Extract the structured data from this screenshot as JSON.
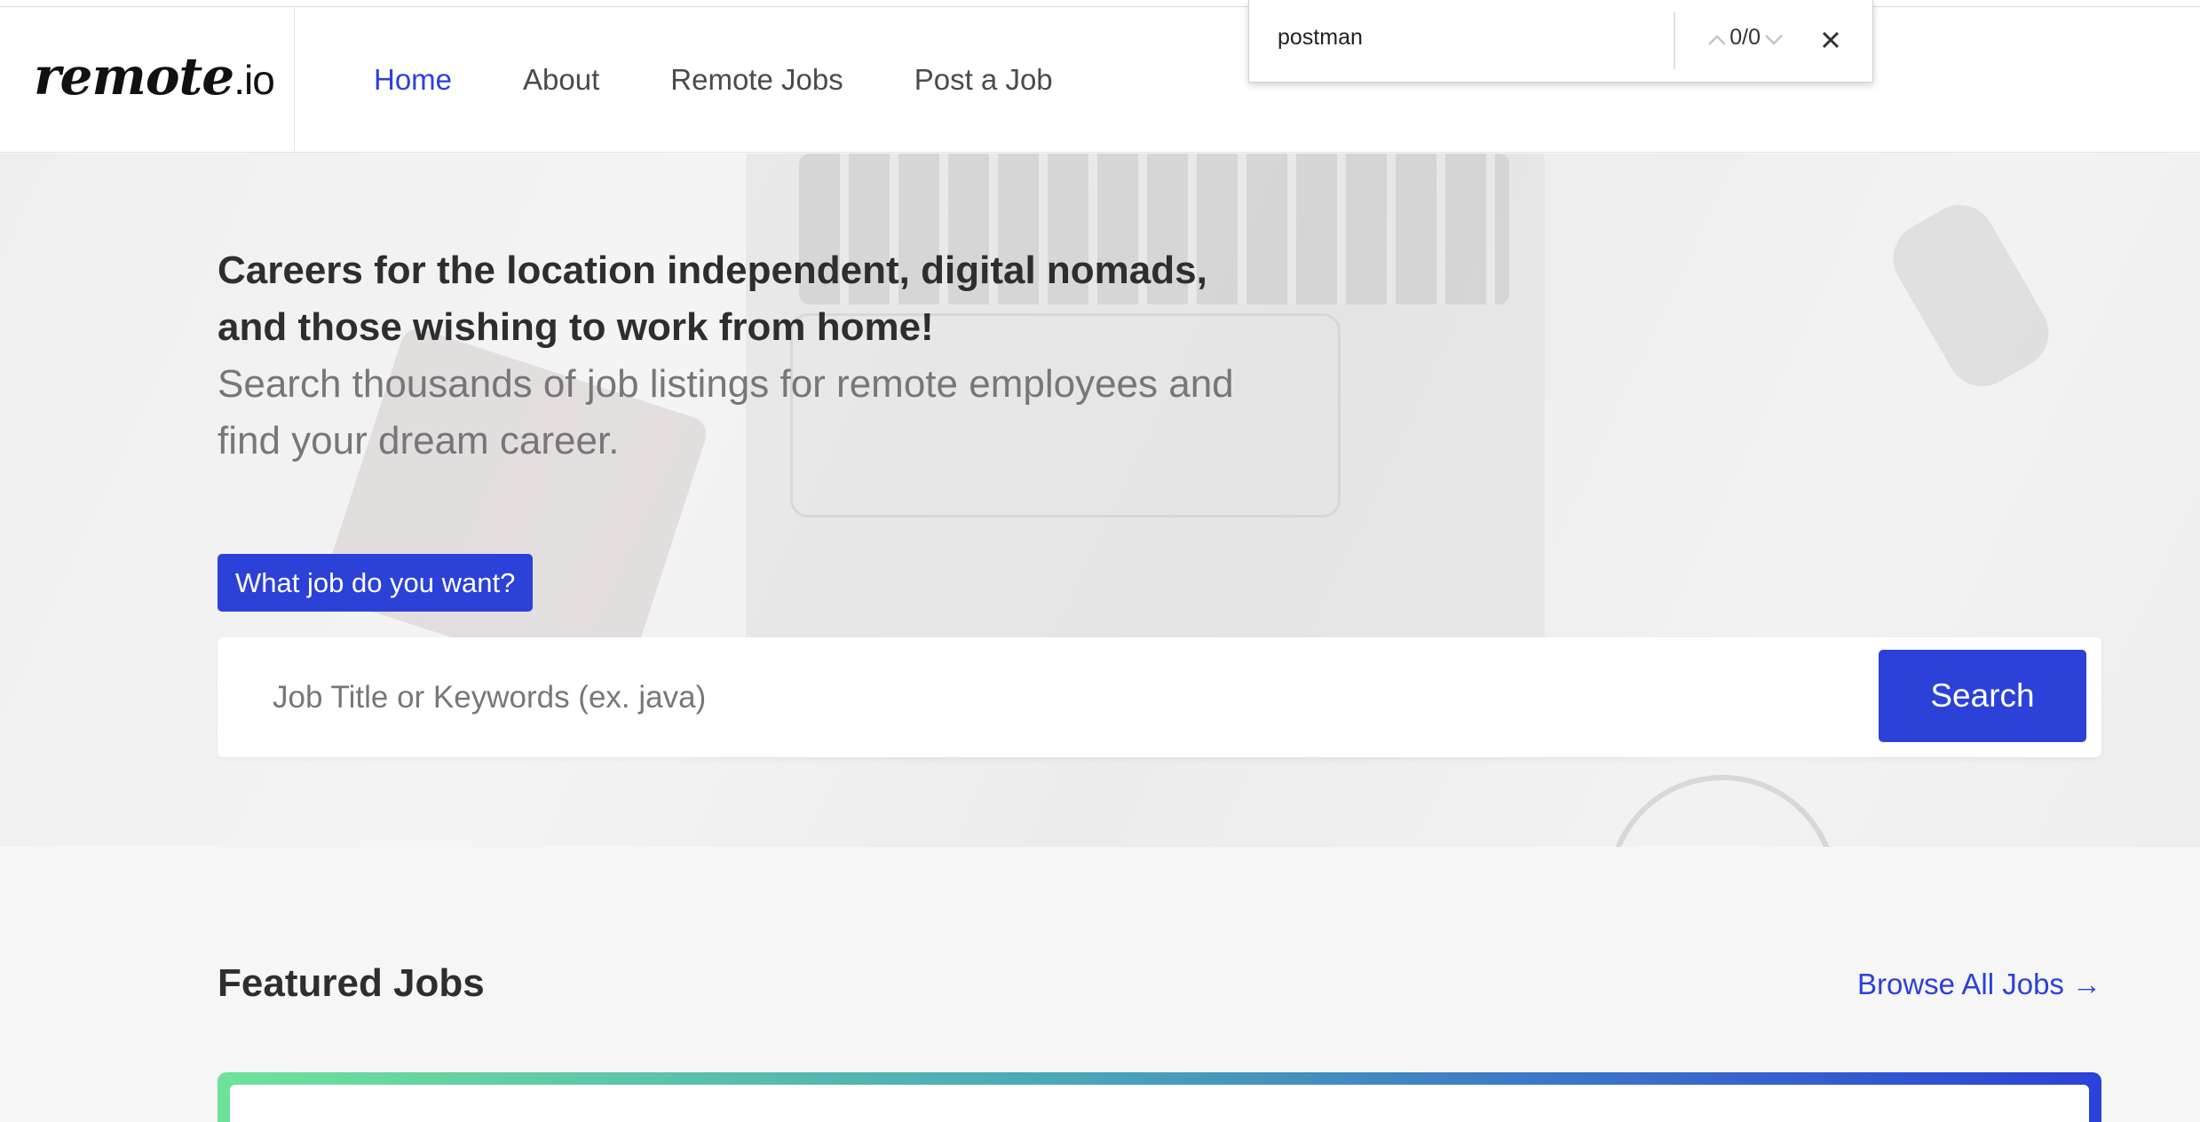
{
  "header": {
    "logo_main": "remote",
    "logo_tld": ".io",
    "nav": [
      {
        "label": "Home",
        "active": true
      },
      {
        "label": "About",
        "active": false
      },
      {
        "label": "Remote Jobs",
        "active": false
      },
      {
        "label": "Post a Job",
        "active": false
      }
    ]
  },
  "find_bar": {
    "query": "postman",
    "count": "0/0",
    "icons": [
      "chevron-up-icon",
      "chevron-down-icon",
      "close-icon"
    ]
  },
  "hero": {
    "title": "Careers for the location independent, digital nomads, and those wishing to work from home!",
    "subtitle": "Search thousands of job listings for remote employees and find your dream career.",
    "prompt_label": "What job do you want?",
    "search_placeholder": "Job Title or Keywords (ex. java)",
    "search_button": "Search"
  },
  "featured": {
    "title": "Featured Jobs",
    "browse_link": "Browse All Jobs →"
  },
  "colors": {
    "accent": "#2c41d8",
    "gradient_start": "#6ce39a",
    "gradient_end": "#2c41d8"
  }
}
